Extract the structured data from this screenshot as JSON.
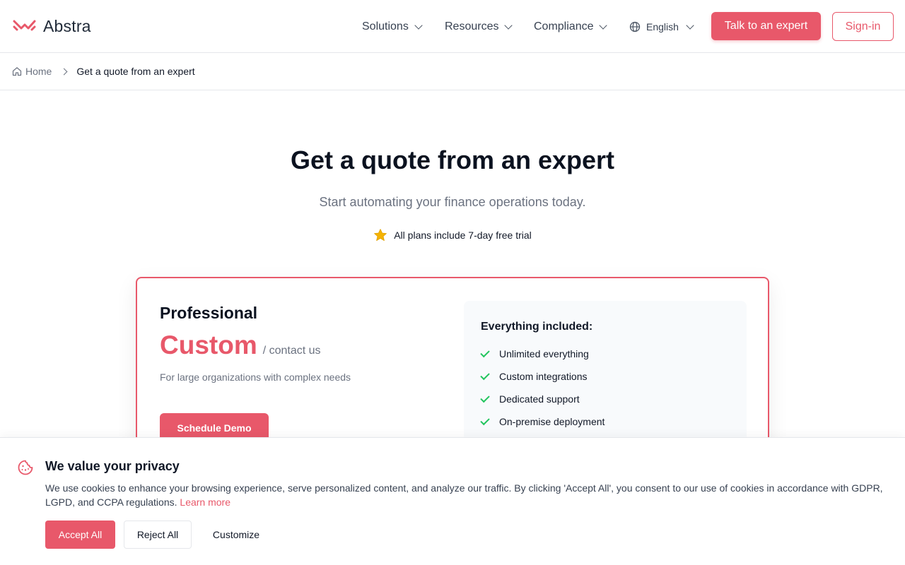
{
  "header": {
    "brand": "Abstra",
    "logo_icon": "abstra-logo-icon",
    "nav": {
      "solutions": "Solutions",
      "resources": "Resources",
      "compliance": "Compliance",
      "language": "English"
    },
    "cta_expert": "Talk to an expert",
    "cta_signin": "Sign-in",
    "accent_color": "#e8586a"
  },
  "breadcrumb": {
    "home": "Home",
    "current": "Get a quote from an expert"
  },
  "hero": {
    "title": "Get a quote from an expert",
    "subtitle": "Start automating your finance operations today.",
    "trial_note": "All plans include 7-day free trial"
  },
  "plan": {
    "name": "Professional",
    "price": "Custom",
    "price_unit": "/ contact us",
    "description": "For large organizations with complex needs",
    "cta": "Schedule Demo",
    "features_title": "Everything included:",
    "features": [
      "Unlimited everything",
      "Custom integrations",
      "Dedicated support",
      "On-premise deployment"
    ]
  },
  "cookie_banner": {
    "title": "We value your privacy",
    "text": "We use cookies to enhance your browsing experience, serve personalized content, and analyze our traffic. By clicking 'Accept All', you consent to our use of cookies in accordance with GDPR, LGPD, and CCPA regulations.",
    "learn_more": "Learn more",
    "accept": "Accept All",
    "reject": "Reject All",
    "customize": "Customize"
  }
}
